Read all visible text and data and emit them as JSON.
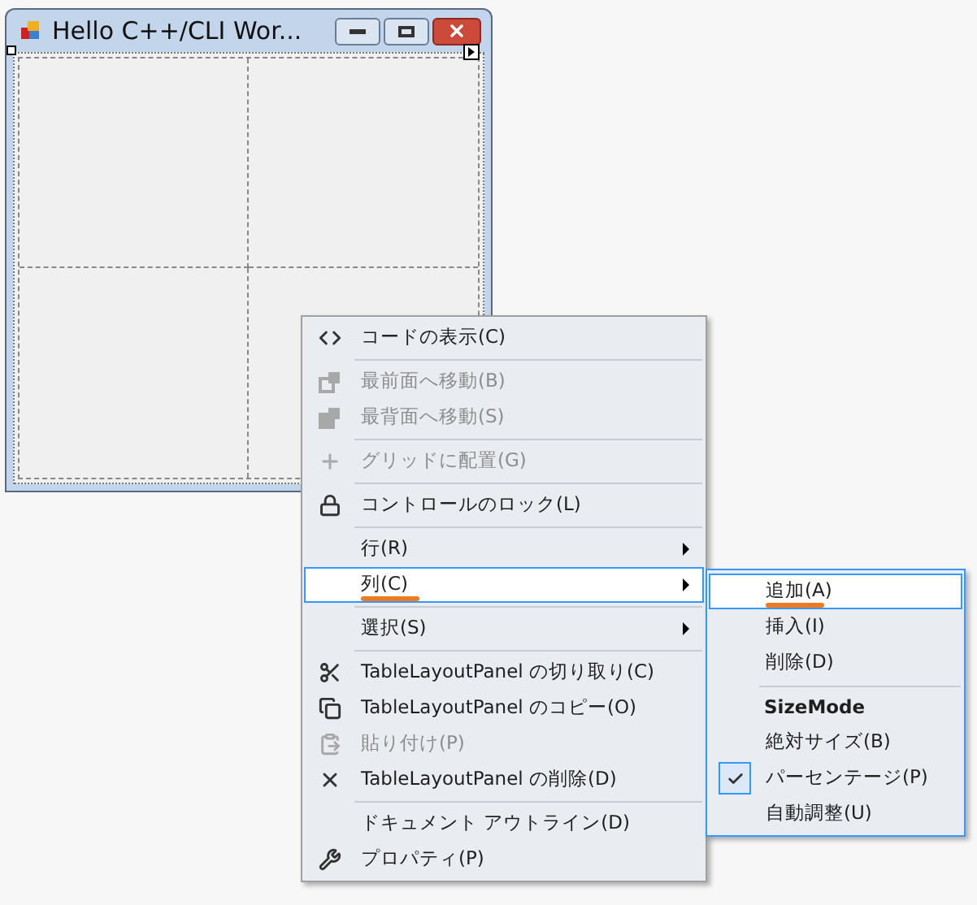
{
  "window": {
    "title": "Hello C++/CLI Wor..."
  },
  "menu": [
    {
      "kind": "item",
      "label": "コードの表示(C)",
      "disabled": false,
      "submenu": false,
      "selected": false,
      "underlined": false
    },
    {
      "kind": "separator"
    },
    {
      "kind": "item",
      "label": "最前面へ移動(B)",
      "disabled": true,
      "submenu": false,
      "selected": false,
      "underlined": false
    },
    {
      "kind": "item",
      "label": "最背面へ移動(S)",
      "disabled": true,
      "submenu": false,
      "selected": false,
      "underlined": false
    },
    {
      "kind": "separator"
    },
    {
      "kind": "item",
      "label": "グリッドに配置(G)",
      "disabled": true,
      "submenu": false,
      "selected": false,
      "underlined": false
    },
    {
      "kind": "separator"
    },
    {
      "kind": "item",
      "label": "コントロールのロック(L)",
      "disabled": false,
      "submenu": false,
      "selected": false,
      "underlined": false
    },
    {
      "kind": "separator"
    },
    {
      "kind": "item",
      "label": "行(R)",
      "disabled": false,
      "submenu": true,
      "selected": false,
      "underlined": false
    },
    {
      "kind": "item",
      "label": "列(C)",
      "disabled": false,
      "submenu": true,
      "selected": true,
      "underlined": true
    },
    {
      "kind": "separator"
    },
    {
      "kind": "item",
      "label": "選択(S)",
      "disabled": false,
      "submenu": true,
      "selected": false,
      "underlined": false
    },
    {
      "kind": "separator"
    },
    {
      "kind": "item",
      "label": "TableLayoutPanel の切り取り(C)",
      "disabled": false,
      "submenu": false,
      "selected": false,
      "underlined": false
    },
    {
      "kind": "item",
      "label": "TableLayoutPanel のコピー(O)",
      "disabled": false,
      "submenu": false,
      "selected": false,
      "underlined": false
    },
    {
      "kind": "item",
      "label": "貼り付け(P)",
      "disabled": true,
      "submenu": false,
      "selected": false,
      "underlined": false
    },
    {
      "kind": "item",
      "label": "TableLayoutPanel の削除(D)",
      "disabled": false,
      "submenu": false,
      "selected": false,
      "underlined": false
    },
    {
      "kind": "separator"
    },
    {
      "kind": "item",
      "label": "ドキュメント アウトライン(D)",
      "disabled": false,
      "submenu": false,
      "selected": false,
      "underlined": false
    },
    {
      "kind": "item",
      "label": "プロパティ(P)",
      "disabled": false,
      "submenu": false,
      "selected": false,
      "underlined": false
    }
  ],
  "submenu": [
    {
      "kind": "item",
      "label": "追加(A)",
      "selected": true,
      "checked": false,
      "underlined": true
    },
    {
      "kind": "item",
      "label": "挿入(I)",
      "selected": false,
      "checked": false,
      "underlined": false
    },
    {
      "kind": "item",
      "label": "削除(D)",
      "selected": false,
      "checked": false,
      "underlined": false
    },
    {
      "kind": "separator"
    },
    {
      "kind": "header",
      "label": "SizeMode"
    },
    {
      "kind": "item",
      "label": "絶対サイズ(B)",
      "selected": false,
      "checked": false,
      "underlined": false
    },
    {
      "kind": "item",
      "label": "パーセンテージ(P)",
      "selected": false,
      "checked": true,
      "underlined": false
    },
    {
      "kind": "item",
      "label": "自動調整(U)",
      "selected": false,
      "checked": false,
      "underlined": false
    }
  ]
}
